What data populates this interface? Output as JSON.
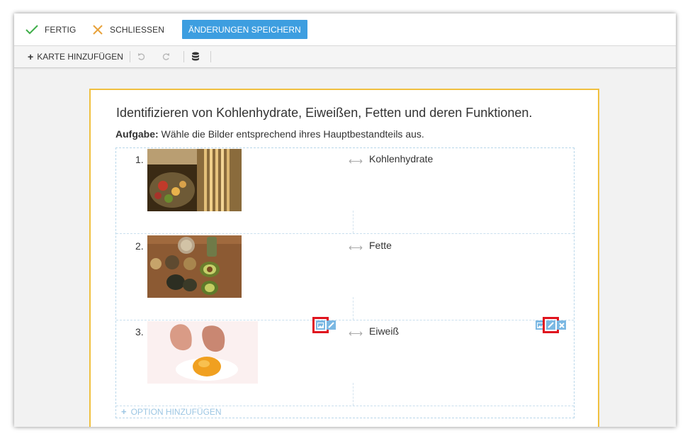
{
  "toolbar": {
    "done_label": "FERTIG",
    "close_label": "SCHLIESSEN",
    "save_label": "ÄNDERUNGEN SPEICHERN"
  },
  "secondary_toolbar": {
    "add_card_label": "KARTE HINZUFÜGEN"
  },
  "card": {
    "title": "Identifizieren von Kohlenhydrate, Eiweißen, Fetten und deren Funktionen.",
    "task_label": "Aufgabe:",
    "task_text": " Wähle die Bilder entsprechend ihres Hauptbestandteils aus.",
    "items": [
      {
        "number": "1.",
        "image": "pasta-grains-photo",
        "answer": "Kohlenhydrate"
      },
      {
        "number": "2.",
        "image": "nuts-avocado-oil-photo",
        "answer": "Fette"
      },
      {
        "number": "3.",
        "image": "cracked-egg-photo",
        "answer": "Eiweiß"
      }
    ],
    "add_option_label": "OPTION HINZUFÜGEN"
  },
  "colors": {
    "accent": "#3d9ee0",
    "card_border": "#f0c040",
    "highlight": "#e0141e",
    "check": "#3fae49",
    "close": "#e8a23b"
  }
}
